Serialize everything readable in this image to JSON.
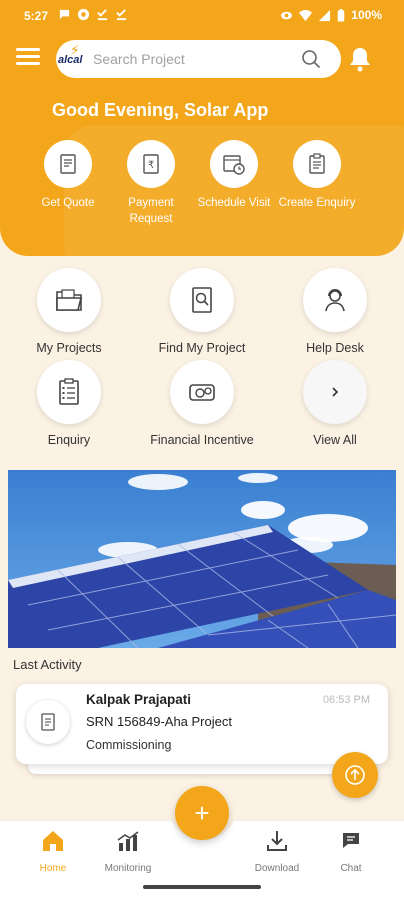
{
  "status_bar": {
    "time": "5:27",
    "battery": "100%"
  },
  "search": {
    "placeholder": "Search Project",
    "logo_text": "alcal"
  },
  "greeting": "Good Evening, Solar App",
  "quick_actions": [
    {
      "label": "Get Quote",
      "icon": "quote-doc-icon"
    },
    {
      "label": "Payment Request",
      "icon": "rupee-doc-icon"
    },
    {
      "label": "Schedule Visit",
      "icon": "calendar-clock-icon"
    },
    {
      "label": "Create Enquiry",
      "icon": "clipboard-icon"
    }
  ],
  "menu": [
    {
      "label": "My Projects",
      "icon": "folder-icon"
    },
    {
      "label": "Find My Project",
      "icon": "search-doc-icon"
    },
    {
      "label": "Help Desk",
      "icon": "support-agent-icon"
    },
    {
      "label": "Enquiry",
      "icon": "checklist-icon"
    },
    {
      "label": "Financial Incentive",
      "icon": "money-icon"
    },
    {
      "label": "View All",
      "icon": "chevron-right-icon"
    }
  ],
  "banner": {
    "description": "solar-panels-banner"
  },
  "last_activity": {
    "heading": "Last Activity",
    "name": "Kalpak Prajapati",
    "srn": "SRN 156849-Aha Project",
    "stage": "Commissioning",
    "time": "06:53 PM"
  },
  "bottom_nav": [
    {
      "label": "Home",
      "icon": "home-icon",
      "active": true
    },
    {
      "label": "Monitoring",
      "icon": "chart-icon",
      "active": false
    },
    {
      "label": "Download",
      "icon": "download-icon",
      "active": false
    },
    {
      "label": "Chat",
      "icon": "chat-icon",
      "active": false
    }
  ],
  "fab_label": "+",
  "colors": {
    "accent": "#f3a61a",
    "background": "#fbf2e4"
  }
}
